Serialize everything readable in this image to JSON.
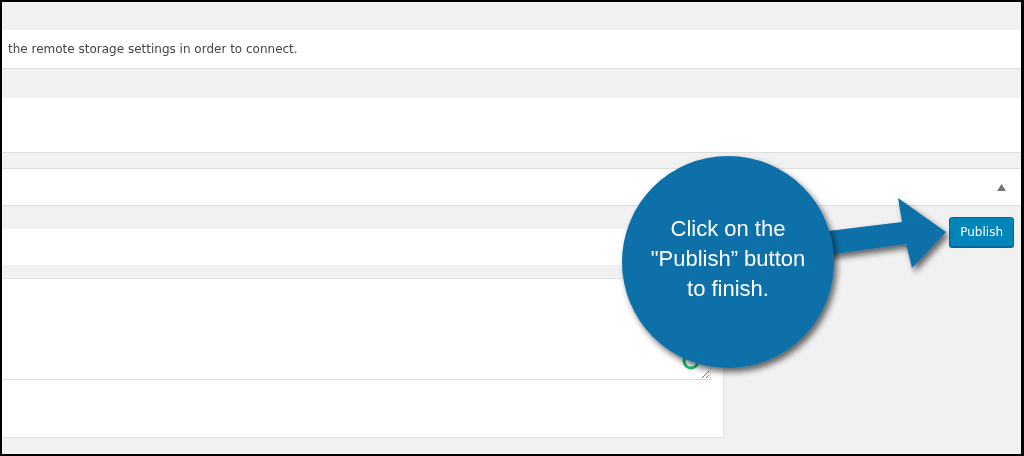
{
  "notice": {
    "text": "the remote storage settings in order to connect."
  },
  "publish_button": {
    "label": "Publish"
  },
  "callout": {
    "text": "Click on the\n\"Publish” button\nto finish."
  }
}
